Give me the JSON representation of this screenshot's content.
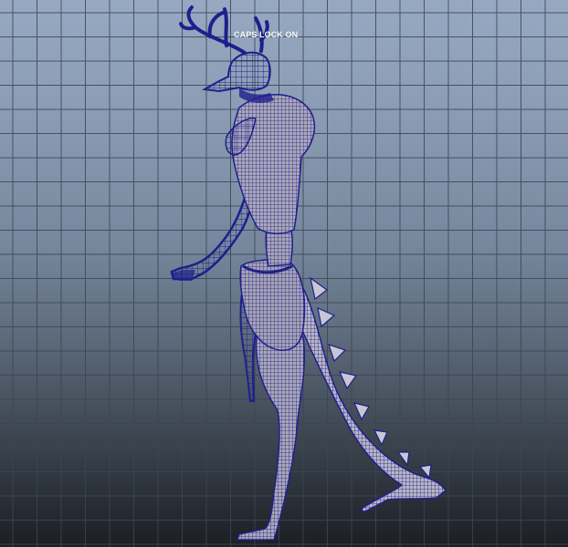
{
  "viewport": {
    "hud_message": "CAPS LOCK ON",
    "background_top": "#97a9c2",
    "background_bottom": "#1c1f24",
    "grid_color": "#3d4552",
    "wireframe_color": "#1f1f8c",
    "wireframe_highlight": "#2b2bb0",
    "model": {
      "type": "wireframe-character",
      "description_icon": "creature-model-icon"
    }
  }
}
